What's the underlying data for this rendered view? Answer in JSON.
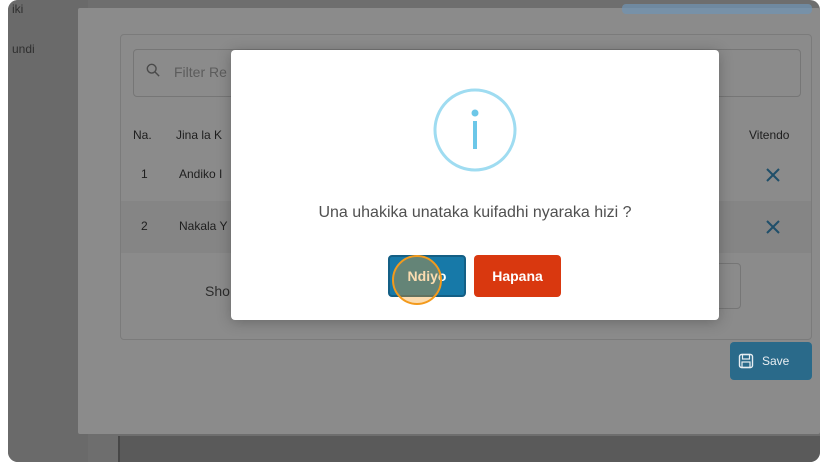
{
  "background": {
    "sidebar_items": [
      "iki",
      "undi"
    ],
    "filter_placeholder": "Filter Re",
    "table": {
      "headers": [
        "Na.",
        "Jina la K",
        "Vitendo"
      ],
      "rows": [
        {
          "num": "1",
          "name": "Andiko I"
        },
        {
          "num": "2",
          "name": "Nakala Y"
        }
      ]
    },
    "show_label": "Sho",
    "save_label": "Save"
  },
  "dialog": {
    "icon": "info-icon",
    "message": "Una uhakika unataka kuifadhi nyaraka hizi ?",
    "confirm_label": "Ndiyo",
    "cancel_label": "Hapana"
  },
  "colors": {
    "confirm": "#1779a8",
    "cancel": "#d9380f",
    "info": "#6cc7e8",
    "cursor_highlight": "#f39a1c"
  }
}
